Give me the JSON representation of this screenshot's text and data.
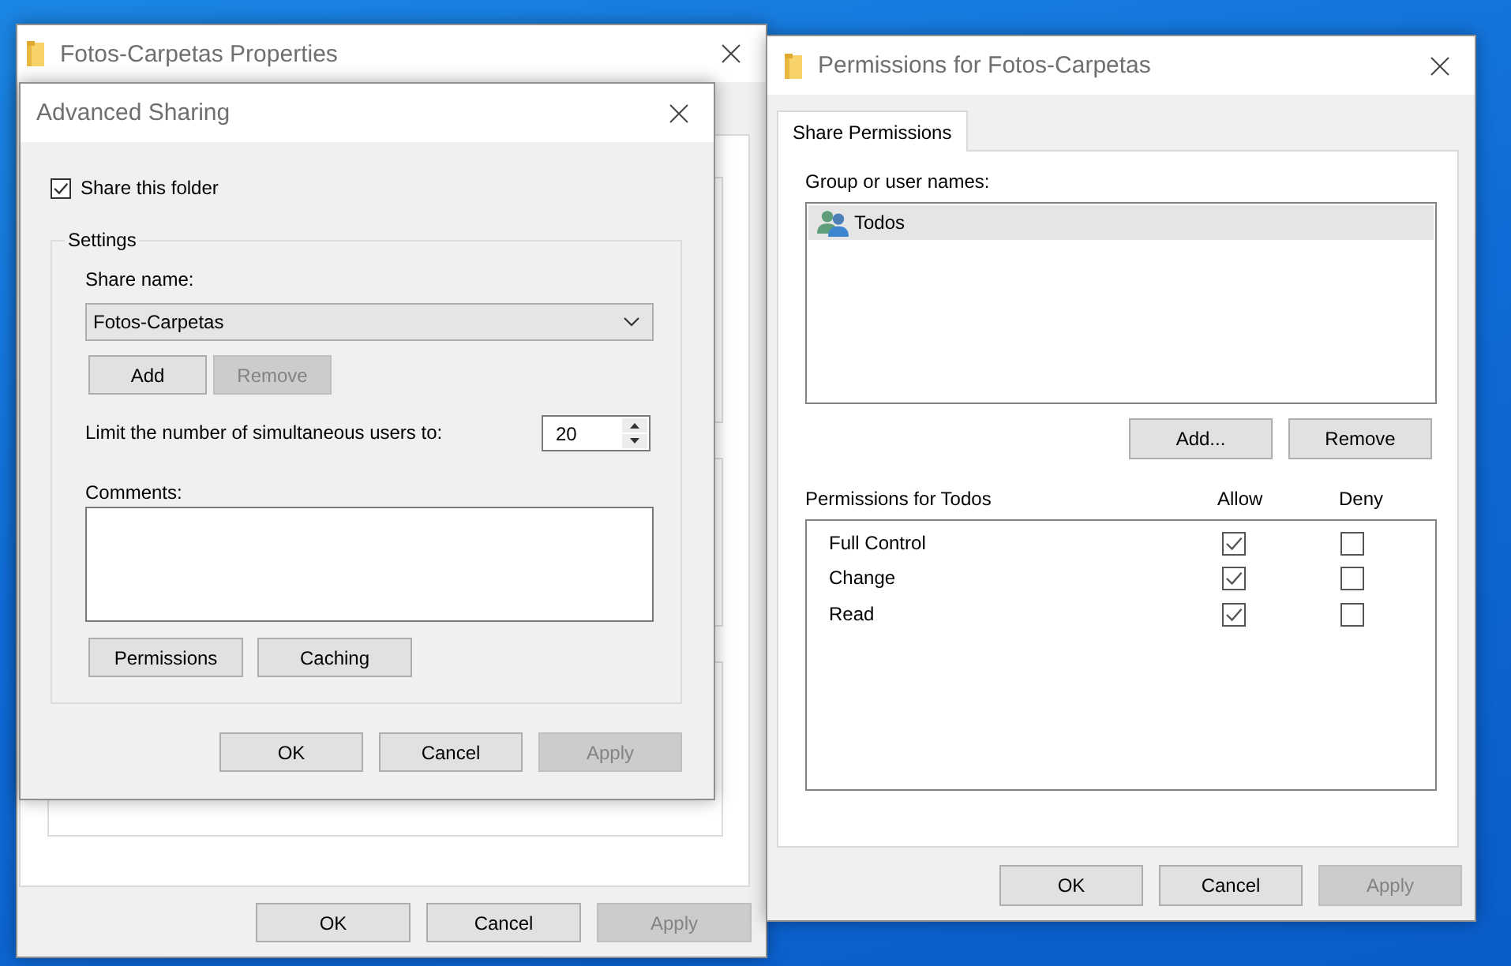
{
  "properties_window": {
    "title": "Fotos-Carpetas Properties",
    "buttons": [
      {
        "label": "OK",
        "disabled": false
      },
      {
        "label": "Cancel",
        "disabled": false
      },
      {
        "label": "Apply",
        "disabled": true
      }
    ]
  },
  "advanced_sharing": {
    "title": "Advanced Sharing",
    "share_folder": {
      "label": "Share this folder",
      "checked": true
    },
    "settings": {
      "legend": "Settings",
      "share_name_label": "Share name:",
      "share_name": "Fotos-Carpetas",
      "share_name_buttons": [
        {
          "label": "Add",
          "disabled": false
        },
        {
          "label": "Remove",
          "disabled": true
        }
      ],
      "user_limit_label": "Limit the number of simultaneous users to:",
      "user_limit": "20",
      "comments_label": "Comments:",
      "buttons": [
        {
          "label": "Permissions",
          "disabled": false
        },
        {
          "label": "Caching",
          "disabled": false
        }
      ]
    },
    "buttons": [
      {
        "label": "OK",
        "disabled": false
      },
      {
        "label": "Cancel",
        "disabled": false
      },
      {
        "label": "Apply",
        "disabled": true
      }
    ]
  },
  "permissions_window": {
    "title": "Permissions for Fotos-Carpetas",
    "tabs": [
      {
        "label": "Share Permissions",
        "selected": true
      }
    ],
    "users_label": "Group or user names:",
    "users": [
      {
        "name": "Todos",
        "selected": true
      }
    ],
    "user_buttons": [
      {
        "label": "Add...",
        "disabled": false
      },
      {
        "label": "Remove",
        "disabled": false
      }
    ],
    "permissions_label": "Permissions for Todos",
    "columns": [
      "Allow",
      "Deny"
    ],
    "permissions": [
      {
        "name": "Full Control",
        "allow": true,
        "deny": false
      },
      {
        "name": "Change",
        "allow": true,
        "deny": false
      },
      {
        "name": "Read",
        "allow": true,
        "deny": false
      }
    ],
    "buttons": [
      {
        "label": "OK",
        "disabled": false
      },
      {
        "label": "Cancel",
        "disabled": false
      },
      {
        "label": "Apply",
        "disabled": true
      }
    ]
  }
}
